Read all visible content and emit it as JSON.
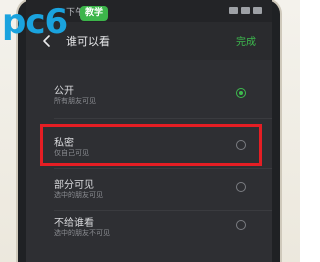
{
  "watermark": {
    "brand": "pc6",
    "badge": "教学"
  },
  "statusbar": {
    "time": "下午3:09"
  },
  "header": {
    "title": "谁可以看",
    "done_label": "完成"
  },
  "options": [
    {
      "label": "公开",
      "desc": "所有朋友可见",
      "selected": true
    },
    {
      "label": "私密",
      "desc": "仅自己可见",
      "selected": false
    },
    {
      "label": "部分可见",
      "desc": "选中的朋友可见",
      "selected": false
    },
    {
      "label": "不给谁看",
      "desc": "选中的朋友不可见",
      "selected": false
    }
  ],
  "colors": {
    "accent": "#3dbb4e",
    "highlight": "#e51e24"
  }
}
